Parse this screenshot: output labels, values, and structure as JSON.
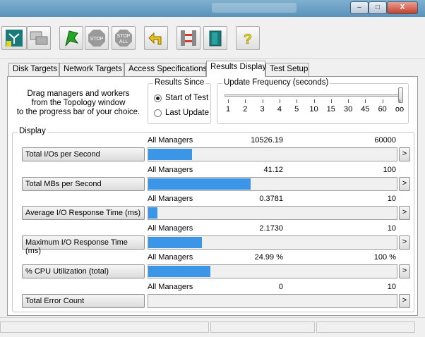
{
  "window": {
    "minimize_label": "–",
    "maximize_label": "□",
    "close_label": "X"
  },
  "toolbar": {
    "buttons": [
      {
        "name": "topology-icon",
        "color": "#1a7a7a"
      },
      {
        "name": "copy-worker-icon",
        "color": "#888888"
      },
      {
        "name": "start-flag-icon",
        "color": "#23a623"
      },
      {
        "name": "stop-icon",
        "label": "STOP",
        "color": "#9a9a9a"
      },
      {
        "name": "stop-all-icon",
        "label_top": "STOP",
        "label_bottom": "ALL",
        "color": "#9a9a9a"
      },
      {
        "name": "reset-arrow-icon",
        "color": "#e8c21b"
      },
      {
        "name": "disconnect-icon",
        "color": "#d23a2c"
      },
      {
        "name": "exit-door-icon",
        "color": "#1a7a7a"
      },
      {
        "name": "help-icon",
        "label": "?",
        "color": "#e8d51b"
      }
    ]
  },
  "tabs": [
    {
      "label": "Disk Targets",
      "active": false
    },
    {
      "label": "Network Targets",
      "active": false
    },
    {
      "label": "Access Specifications",
      "active": false
    },
    {
      "label": "Results Display",
      "active": true
    },
    {
      "label": "Test Setup",
      "active": false
    }
  ],
  "instructions": {
    "line1": "Drag managers and workers",
    "line2": "from the Topology window",
    "line3": "to the progress bar of your choice."
  },
  "results_since": {
    "title": "Results Since",
    "options": [
      "Start of Test",
      "Last Update"
    ],
    "selected": "Start of Test"
  },
  "update_frequency": {
    "title": "Update Frequency (seconds)",
    "ticks": [
      "1",
      "2",
      "3",
      "4",
      "5",
      "10",
      "15",
      "30",
      "45",
      "60",
      "oo"
    ],
    "selected": "oo"
  },
  "display": {
    "title": "Display",
    "metrics": [
      {
        "button": "Total I/Os per Second",
        "source": "All Managers",
        "value": "10526.19",
        "max": "60000",
        "fraction": 0.175,
        "arrow": ">"
      },
      {
        "button": "Total MBs per Second",
        "source": "All Managers",
        "value": "41.12",
        "max": "100",
        "fraction": 0.4112,
        "arrow": ">"
      },
      {
        "button": "Average I/O Response Time (ms)",
        "source": "All Managers",
        "value": "0.3781",
        "max": "10",
        "fraction": 0.0378,
        "arrow": ">"
      },
      {
        "button": "Maximum I/O Response Time (ms)",
        "source": "All Managers",
        "value": "2.1730",
        "max": "10",
        "fraction": 0.2173,
        "arrow": ">"
      },
      {
        "button": "% CPU Utilization (total)",
        "source": "All Managers",
        "value": "24.99 %",
        "max": "100 %",
        "fraction": 0.2499,
        "arrow": ">"
      },
      {
        "button": "Total Error Count",
        "source": "All Managers",
        "value": "0",
        "max": "10",
        "fraction": 0,
        "arrow": ">"
      }
    ]
  },
  "colors": {
    "bar_fill": "#3c96e8",
    "title_bar": "#5a92bb"
  }
}
